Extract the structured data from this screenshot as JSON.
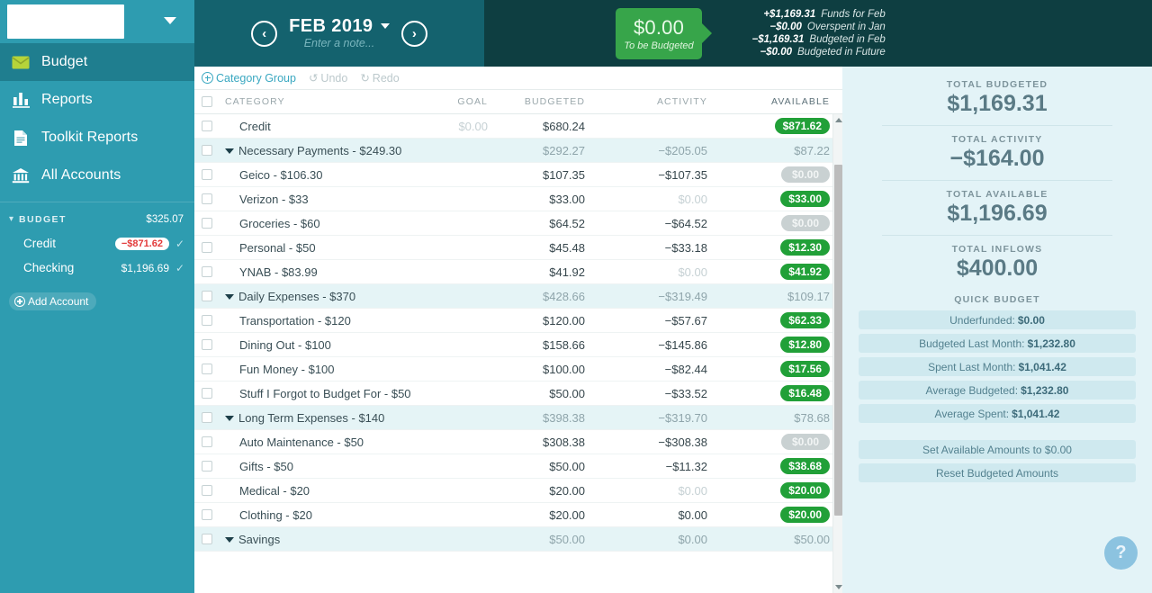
{
  "sidebar": {
    "budget_name": "",
    "nav": [
      {
        "label": "Budget",
        "icon": "envelope-icon",
        "active": true
      },
      {
        "label": "Reports",
        "icon": "bar-chart-icon",
        "active": false
      },
      {
        "label": "Toolkit Reports",
        "icon": "document-icon",
        "active": false
      },
      {
        "label": "All Accounts",
        "icon": "bank-icon",
        "active": false
      }
    ],
    "account_group": {
      "label": "BUDGET",
      "total": "$325.07"
    },
    "accounts": [
      {
        "name": "Credit",
        "balance": "−$871.62",
        "negative": true
      },
      {
        "name": "Checking",
        "balance": "$1,196.69",
        "negative": false
      }
    ],
    "add_account_label": "Add Account"
  },
  "header": {
    "prev_label": "‹",
    "next_label": "›",
    "month": "FEB 2019",
    "note_placeholder": "Enter a note...",
    "to_be_budgeted": {
      "amount": "$0.00",
      "label": "To be Budgeted"
    },
    "breakdown": [
      {
        "amount": "+$1,169.31",
        "label": "Funds for Feb"
      },
      {
        "amount": "−$0.00",
        "label": "Overspent in Jan"
      },
      {
        "amount": "−$1,169.31",
        "label": "Budgeted in Feb"
      },
      {
        "amount": "−$0.00",
        "label": "Budgeted in Future"
      }
    ]
  },
  "toolbar": {
    "category_group_label": "Category Group",
    "undo_label": "Undo",
    "redo_label": "Redo"
  },
  "table": {
    "columns": {
      "category": "CATEGORY",
      "goal": "GOAL",
      "budgeted": "BUDGETED",
      "activity": "ACTIVITY",
      "available": "AVAILABLE"
    },
    "rows": [
      {
        "type": "category",
        "name": "Credit",
        "goal": "$0.00",
        "goal_muted": true,
        "budgeted": "$680.24",
        "budgeted_muted": false,
        "activity": "",
        "available": "$871.62",
        "available_style": "green"
      },
      {
        "type": "group",
        "name": "Necessary Payments - $249.30",
        "goal": "",
        "budgeted": "$292.27",
        "activity": "−$205.05",
        "available": "$87.22"
      },
      {
        "type": "category",
        "name": "Geico - $106.30",
        "goal": "",
        "budgeted": "$107.35",
        "activity": "−$107.35",
        "activity_muted": false,
        "available": "$0.00",
        "available_style": "gray"
      },
      {
        "type": "category",
        "name": "Verizon - $33",
        "goal": "",
        "budgeted": "$33.00",
        "activity": "$0.00",
        "activity_muted": true,
        "available": "$33.00",
        "available_style": "green"
      },
      {
        "type": "category",
        "name": "Groceries - $60",
        "goal": "",
        "budgeted": "$64.52",
        "activity": "−$64.52",
        "activity_muted": false,
        "available": "$0.00",
        "available_style": "gray"
      },
      {
        "type": "category",
        "name": "Personal - $50",
        "goal": "",
        "budgeted": "$45.48",
        "activity": "−$33.18",
        "activity_muted": false,
        "available": "$12.30",
        "available_style": "green"
      },
      {
        "type": "category",
        "name": "YNAB - $83.99",
        "goal": "",
        "budgeted": "$41.92",
        "activity": "$0.00",
        "activity_muted": true,
        "available": "$41.92",
        "available_style": "green"
      },
      {
        "type": "group",
        "name": "Daily Expenses - $370",
        "goal": "",
        "budgeted": "$428.66",
        "activity": "−$319.49",
        "available": "$109.17"
      },
      {
        "type": "category",
        "name": "Transportation - $120",
        "goal": "",
        "budgeted": "$120.00",
        "activity": "−$57.67",
        "activity_muted": false,
        "available": "$62.33",
        "available_style": "green"
      },
      {
        "type": "category",
        "name": "Dining Out - $100",
        "goal": "",
        "budgeted": "$158.66",
        "activity": "−$145.86",
        "activity_muted": false,
        "available": "$12.80",
        "available_style": "green"
      },
      {
        "type": "category",
        "name": "Fun Money - $100",
        "goal": "",
        "budgeted": "$100.00",
        "activity": "−$82.44",
        "activity_muted": false,
        "available": "$17.56",
        "available_style": "green"
      },
      {
        "type": "category",
        "name": "Stuff I Forgot to Budget For - $50",
        "goal": "",
        "budgeted": "$50.00",
        "activity": "−$33.52",
        "activity_muted": false,
        "available": "$16.48",
        "available_style": "green"
      },
      {
        "type": "group",
        "name": "Long Term Expenses - $140",
        "goal": "",
        "budgeted": "$398.38",
        "activity": "−$319.70",
        "available": "$78.68"
      },
      {
        "type": "category",
        "name": "Auto Maintenance - $50",
        "goal": "",
        "budgeted": "$308.38",
        "activity": "−$308.38",
        "activity_muted": false,
        "available": "$0.00",
        "available_style": "gray"
      },
      {
        "type": "category",
        "name": "Gifts - $50",
        "goal": "",
        "budgeted": "$50.00",
        "activity": "−$11.32",
        "activity_muted": false,
        "available": "$38.68",
        "available_style": "green"
      },
      {
        "type": "category",
        "name": "Medical - $20",
        "goal": "",
        "budgeted": "$20.00",
        "activity": "$0.00",
        "activity_muted": true,
        "available": "$20.00",
        "available_style": "green"
      },
      {
        "type": "category",
        "name": "Clothing - $20",
        "goal": "",
        "budgeted": "$20.00",
        "activity": "$0.00",
        "activity_muted": false,
        "available": "$20.00",
        "available_style": "green"
      },
      {
        "type": "group",
        "name": "Savings",
        "goal": "",
        "budgeted": "$50.00",
        "activity": "$0.00",
        "available": "$50.00"
      }
    ]
  },
  "inspector": {
    "totals": [
      {
        "label": "TOTAL BUDGETED",
        "value": "$1,169.31"
      },
      {
        "label": "TOTAL ACTIVITY",
        "value": "−$164.00"
      },
      {
        "label": "TOTAL AVAILABLE",
        "value": "$1,196.69"
      },
      {
        "label": "TOTAL INFLOWS",
        "value": "$400.00"
      }
    ],
    "quick_budget_title": "QUICK BUDGET",
    "quick_budget": [
      {
        "label": "Underfunded:",
        "value": "$0.00"
      },
      {
        "label": "Budgeted Last Month:",
        "value": "$1,232.80"
      },
      {
        "label": "Spent Last Month:",
        "value": "$1,041.42"
      },
      {
        "label": "Average Budgeted:",
        "value": "$1,232.80"
      },
      {
        "label": "Average Spent:",
        "value": "$1,041.42"
      }
    ],
    "actions": [
      {
        "label": "Set Available Amounts to $0.00"
      },
      {
        "label": "Reset Budgeted Amounts"
      }
    ],
    "help_label": "?"
  }
}
